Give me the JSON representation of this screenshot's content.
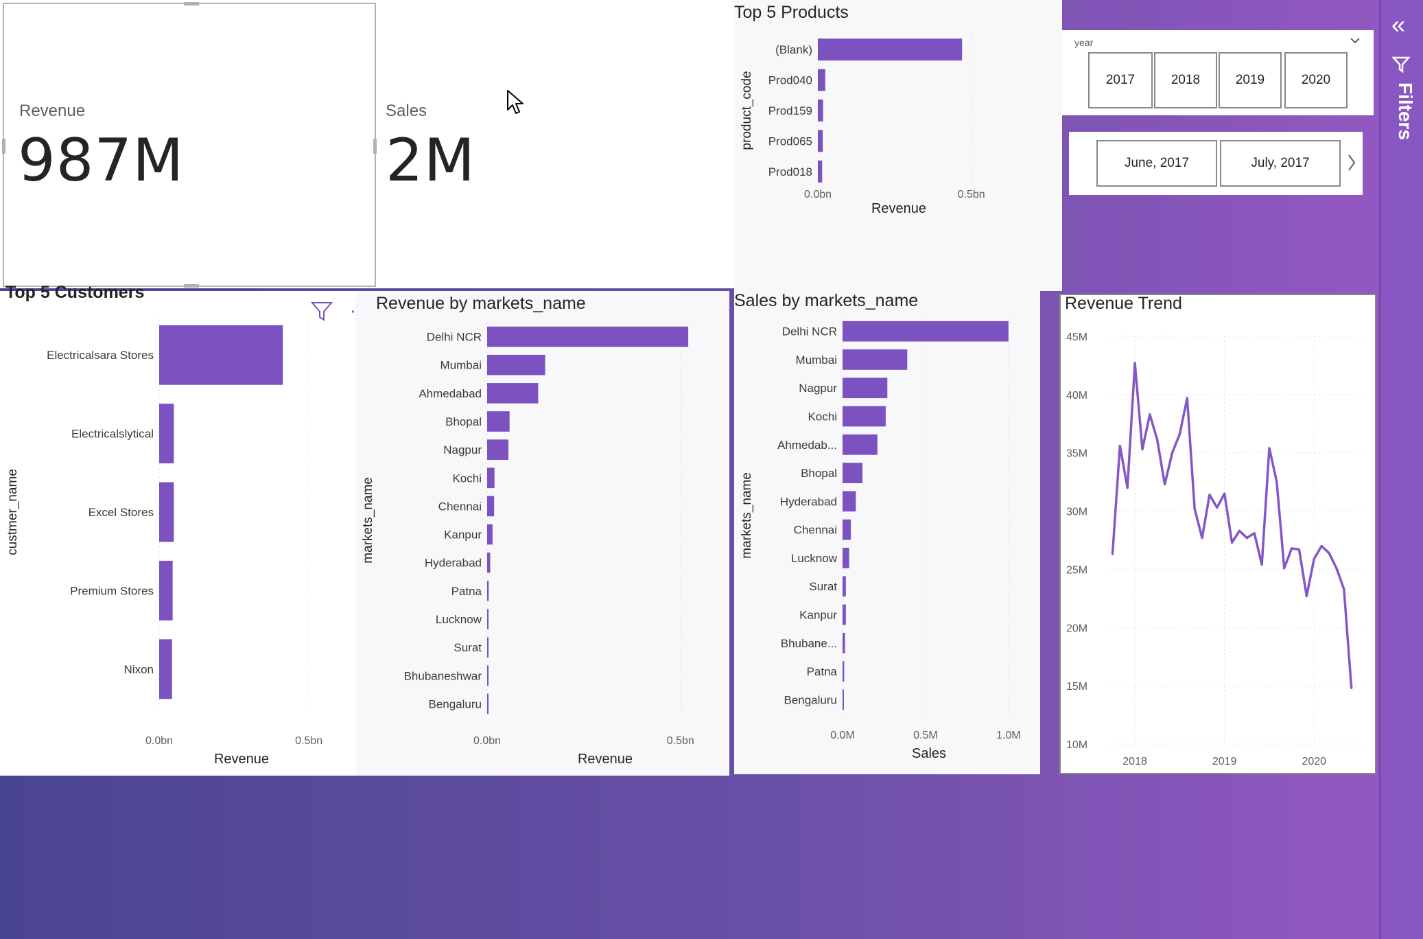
{
  "kpis": {
    "revenue": {
      "label": "Revenue",
      "value": "987M"
    },
    "sales": {
      "label": "Sales",
      "value": "2M"
    }
  },
  "filters": {
    "label": "Filters",
    "collapse_icon": "double-chevron-left-icon",
    "funnel_icon": "filter-funnel-icon"
  },
  "year_slicer": {
    "header": "year",
    "options": [
      "2017",
      "2018",
      "2019",
      "2020"
    ],
    "month_options": [
      "June, 2017",
      "July, 2017"
    ]
  },
  "colors": {
    "bar": "#7b52bf",
    "line": "#8457c6",
    "page_bg_start": "#4a4590",
    "page_bg_end": "#9659c3"
  },
  "chart_data": [
    {
      "id": "top5products",
      "type": "bar",
      "orientation": "horizontal",
      "title": "Top 5 Products",
      "xlabel": "Revenue",
      "ylabel": "product_code",
      "categories": [
        "(Blank)",
        "Prod040",
        "Prod159",
        "Prod065",
        "Prod018"
      ],
      "values": [
        0.47,
        0.024,
        0.017,
        0.016,
        0.014
      ],
      "xlim": [
        0,
        0.55
      ],
      "xticks": [
        "0.0bn",
        "0.5bn"
      ],
      "grid": true
    },
    {
      "id": "top5customers",
      "type": "bar",
      "orientation": "horizontal",
      "title": "Top 5 Customers",
      "xlabel": "Revenue",
      "ylabel": "custmer_name",
      "categories": [
        "Electricalsara Stores",
        "Electricalslytical",
        "Excel Stores",
        "Premium Stores",
        "Nixon"
      ],
      "values": [
        0.413,
        0.049,
        0.049,
        0.045,
        0.043
      ],
      "xlim": [
        0,
        0.55
      ],
      "xticks": [
        "0.0bn",
        "0.5bn"
      ],
      "grid": true
    },
    {
      "id": "revenue_by_market",
      "type": "bar",
      "orientation": "horizontal",
      "title": "Revenue by markets_name",
      "xlabel": "Revenue",
      "ylabel": "markets_name",
      "categories": [
        "Delhi NCR",
        "Mumbai",
        "Ahmedabad",
        "Bhopal",
        "Nagpur",
        "Kochi",
        "Chennai",
        "Kanpur",
        "Hyderabad",
        "Patna",
        "Lucknow",
        "Surat",
        "Bhubaneshwar",
        "Bengaluru"
      ],
      "values": [
        0.52,
        0.15,
        0.132,
        0.058,
        0.055,
        0.019,
        0.018,
        0.014,
        0.008,
        0.004,
        0.003,
        0.002,
        0.002,
        0.001
      ],
      "xlim": [
        0,
        0.55
      ],
      "xticks": [
        "0.0bn",
        "0.5bn"
      ],
      "grid": true
    },
    {
      "id": "sales_by_market",
      "type": "bar",
      "orientation": "horizontal",
      "title": "Sales by markets_name",
      "xlabel": "Sales",
      "ylabel": "markets_name",
      "categories": [
        "Delhi NCR",
        "Mumbai",
        "Nagpur",
        "Kochi",
        "Ahmedab...",
        "Bhopal",
        "Hyderabad",
        "Chennai",
        "Lucknow",
        "Surat",
        "Kanpur",
        "Bhubane...",
        "Patna",
        "Bengaluru"
      ],
      "values": [
        1.0,
        0.39,
        0.27,
        0.26,
        0.21,
        0.12,
        0.08,
        0.05,
        0.04,
        0.02,
        0.02,
        0.015,
        0.01,
        0.007
      ],
      "xlim": [
        0,
        1.1
      ],
      "xticks": [
        "0.0M",
        "0.5M",
        "1.0M"
      ],
      "grid": true
    },
    {
      "id": "revenue_trend",
      "type": "line",
      "title": "Revenue Trend",
      "x": [
        "2017-10",
        "2017-11",
        "2017-12",
        "2018-01",
        "2018-02",
        "2018-03",
        "2018-04",
        "2018-05",
        "2018-06",
        "2018-07",
        "2018-08",
        "2018-09",
        "2018-10",
        "2018-11",
        "2018-12",
        "2019-01",
        "2019-02",
        "2019-03",
        "2019-04",
        "2019-05",
        "2019-06",
        "2019-07",
        "2019-08",
        "2019-09",
        "2019-10",
        "2019-11",
        "2019-12",
        "2020-01",
        "2020-02",
        "2020-03",
        "2020-04",
        "2020-05",
        "2020-06"
      ],
      "values": [
        26.3,
        35.6,
        32.0,
        42.7,
        35.3,
        38.3,
        36.1,
        32.3,
        35.0,
        36.6,
        39.7,
        30.2,
        27.7,
        31.4,
        30.3,
        31.5,
        27.3,
        28.3,
        27.7,
        28.1,
        25.4,
        35.4,
        32.5,
        25.1,
        26.8,
        26.7,
        22.7,
        25.9,
        27.0,
        26.4,
        25.1,
        23.3,
        14.8
      ],
      "ylim": [
        10,
        45
      ],
      "yticks": [
        "10M",
        "15M",
        "20M",
        "25M",
        "30M",
        "35M",
        "40M",
        "45M"
      ],
      "xticks": [
        "2018",
        "2019",
        "2020"
      ],
      "grid": true
    }
  ]
}
